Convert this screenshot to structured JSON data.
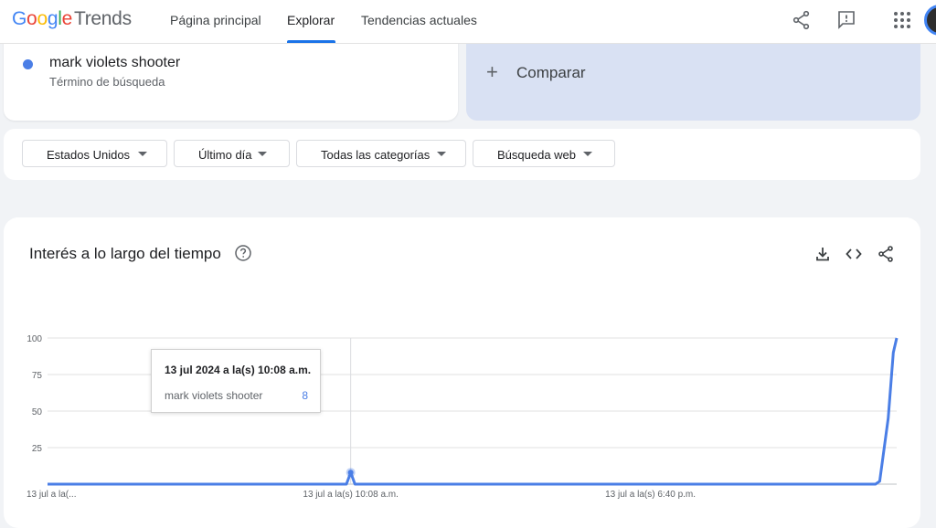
{
  "header": {
    "logo_google": "Google",
    "logo_trends": "Trends",
    "tabs": [
      {
        "label": "Página principal"
      },
      {
        "label": "Explorar"
      },
      {
        "label": "Tendencias actuales"
      }
    ],
    "icons": [
      "share-icon",
      "feedback-icon",
      "apps-grid-icon"
    ]
  },
  "term": {
    "name": "mark violets shooter",
    "subtitle": "Término de búsqueda",
    "color": "#4a7ee6"
  },
  "compare": {
    "label": "Comparar"
  },
  "filters": [
    {
      "label": "Estados Unidos"
    },
    {
      "label": "Último día"
    },
    {
      "label": "Todas las categorías"
    },
    {
      "label": "Búsqueda web"
    }
  ],
  "chart_section": {
    "title": "Interés a lo largo del tiempo",
    "actions": [
      "download-icon",
      "embed-icon",
      "share-icon"
    ]
  },
  "tooltip": {
    "title": "13 jul 2024 a la(s) 10:08 a.m.",
    "term": "mark violets shooter",
    "value": "8"
  },
  "chart_data": {
    "type": "line",
    "ylim": [
      0,
      100
    ],
    "yticks": [
      25,
      50,
      75,
      100
    ],
    "xticks": [
      "13 jul a la(...",
      "13 jul a la(s) 10:08 a.m.",
      "13 jul a la(s) 6:40 p.m."
    ],
    "series": [
      {
        "name": "mark violets shooter",
        "color": "#4a7ee6",
        "points": [
          [
            0,
            0
          ],
          [
            0.352,
            0
          ],
          [
            0.357,
            8
          ],
          [
            0.362,
            0
          ],
          [
            0.975,
            0
          ],
          [
            0.98,
            2
          ],
          [
            0.99,
            45
          ],
          [
            0.996,
            90
          ],
          [
            1.0,
            100
          ]
        ]
      }
    ],
    "highlight_index": 2
  }
}
